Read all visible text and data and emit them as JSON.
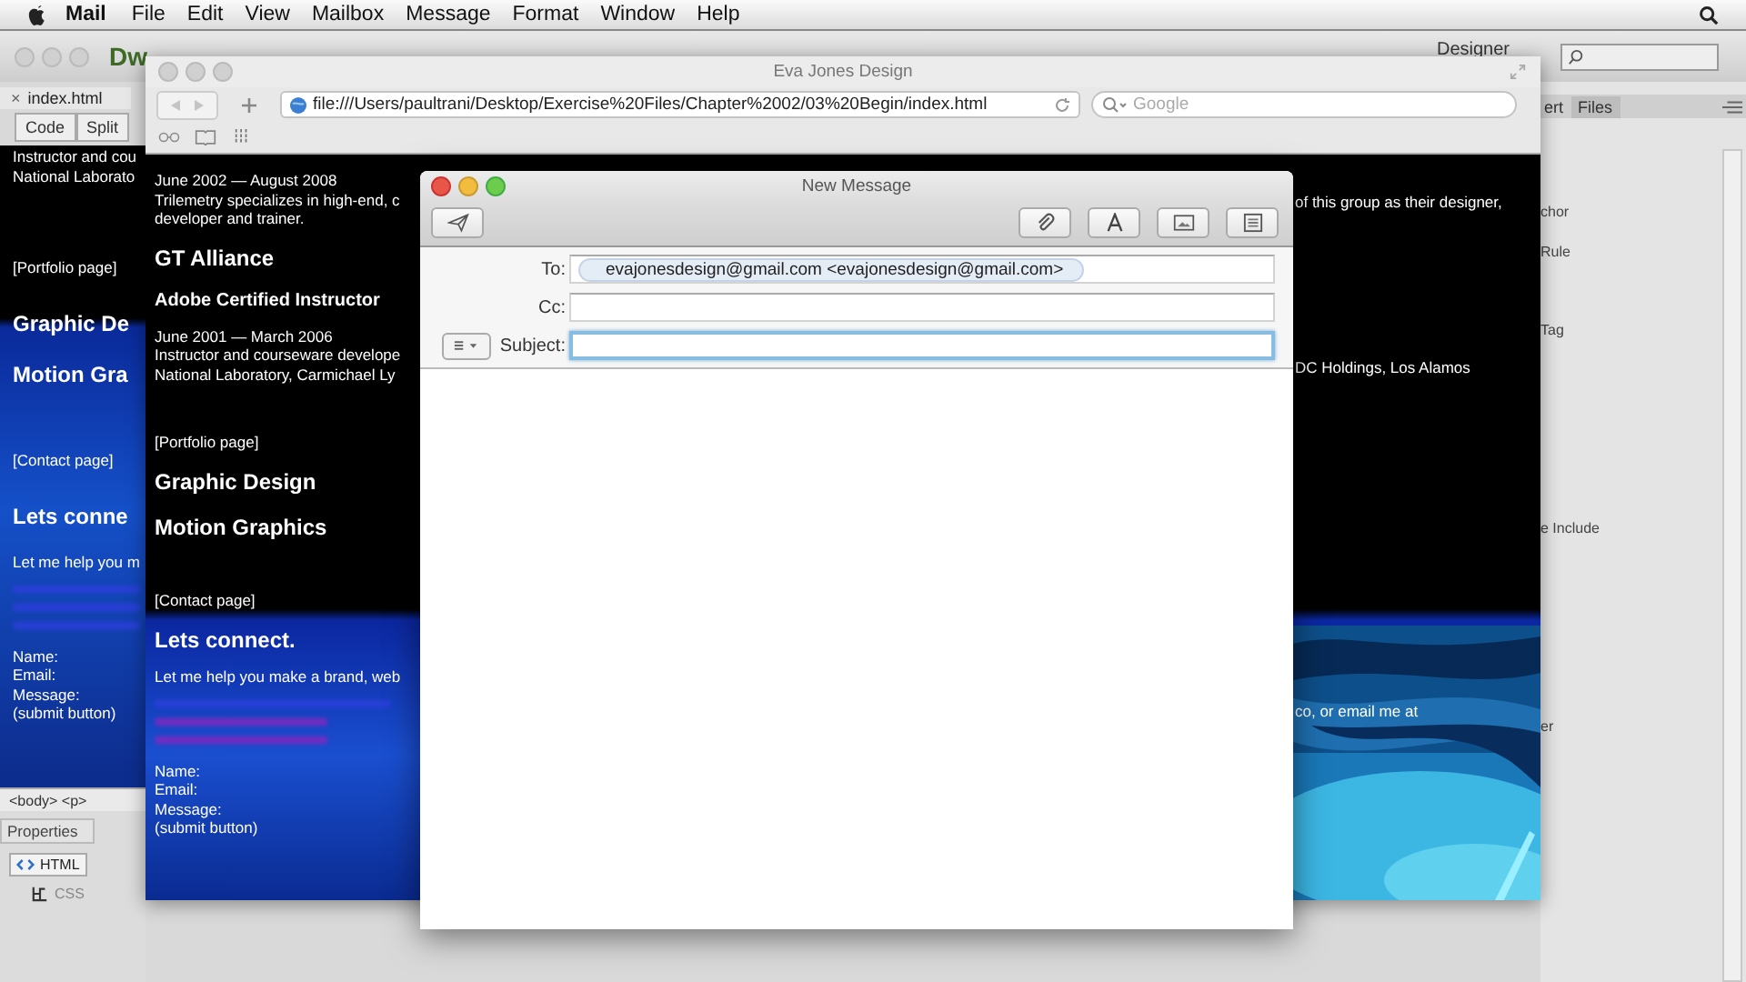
{
  "menubar": {
    "app_name": "Mail",
    "menus": [
      "File",
      "Edit",
      "View",
      "Mailbox",
      "Message",
      "Format",
      "Window",
      "Help"
    ]
  },
  "dreamweaver": {
    "logo": "Dw",
    "workspace": "Designer",
    "document_tab": {
      "close": "×",
      "label": "index.html"
    },
    "view_buttons": [
      "Code",
      "Split"
    ],
    "page": [
      {
        "kind": "small",
        "text": "Instructor and cou"
      },
      {
        "kind": "small",
        "text": "National Laborato"
      },
      {
        "kind": "placeholder",
        "text": "[Portfolio page]"
      },
      {
        "kind": "heading",
        "text": "Graphic De"
      },
      {
        "kind": "heading",
        "text": "Motion Gra"
      },
      {
        "kind": "placeholder",
        "text": "[Contact page]"
      },
      {
        "kind": "heading",
        "text": "Lets conne"
      },
      {
        "kind": "small",
        "text": "Let me help you m"
      },
      {
        "kind": "link"
      },
      {
        "kind": "link"
      },
      {
        "kind": "link"
      },
      {
        "kind": "form",
        "text": "Name:"
      },
      {
        "kind": "small",
        "text": "Email:"
      },
      {
        "kind": "small",
        "text": "Message:"
      },
      {
        "kind": "small",
        "text": "(submit button)"
      }
    ],
    "tag_selector": "<body> <p>",
    "properties_tab": "Properties",
    "property_modes": [
      {
        "label": "HTML",
        "selected": true
      },
      {
        "label": "CSS",
        "selected": false
      }
    ],
    "panel_tabs": [
      "ert",
      "Files"
    ],
    "panel_items": [
      "chor",
      "Rule",
      "Tag",
      "e Include",
      "er"
    ]
  },
  "browser": {
    "title": "Eva Jones Design",
    "url": "file:///Users/paultrani/Desktop/Exercise%20Files/Chapter%2002/03%20Begin/index.html",
    "search_placeholder": "Google",
    "page": [
      {
        "kind": "small",
        "text": "June 2002 — August 2008"
      },
      {
        "kind": "small",
        "text": "Trilemetry specializes in high-end, c"
      },
      {
        "kind": "small",
        "text": "developer and trainer."
      },
      {
        "kind": "heading",
        "text": "GT Alliance"
      },
      {
        "kind": "subheading",
        "text": "Adobe Certified Instructor"
      },
      {
        "kind": "small",
        "text": "June 2001 — March 2006"
      },
      {
        "kind": "small",
        "text": "Instructor and courseware develope"
      },
      {
        "kind": "small",
        "text": "National Laboratory, Carmichael Ly"
      },
      {
        "kind": "placeholder",
        "text": "[Portfolio page]"
      },
      {
        "kind": "heading",
        "text": "Graphic Design"
      },
      {
        "kind": "heading",
        "text": "Motion Graphics"
      },
      {
        "kind": "placeholder",
        "text": "[Contact page]"
      },
      {
        "kind": "heading",
        "text": "Lets connect."
      },
      {
        "kind": "small",
        "text": "Let me help you make a brand, web"
      },
      {
        "kind": "link"
      },
      {
        "kind": "visited"
      },
      {
        "kind": "visited"
      },
      {
        "kind": "form",
        "text": "Name:"
      },
      {
        "kind": "small",
        "text": "Email:"
      },
      {
        "kind": "small",
        "text": "Message:"
      },
      {
        "kind": "small",
        "text": "(submit button)"
      }
    ],
    "right_fragments": [
      "of this group as their designer,",
      "DC Holdings, Los Alamos",
      "co, or email me at"
    ]
  },
  "mail": {
    "title": "New Message",
    "to": {
      "label": "To:",
      "recipient": "evajonesdesign@gmail.com  <evajonesdesign@gmail.com>"
    },
    "cc": {
      "label": "Cc:"
    },
    "subject": {
      "label": "Subject:",
      "focused": true
    }
  }
}
